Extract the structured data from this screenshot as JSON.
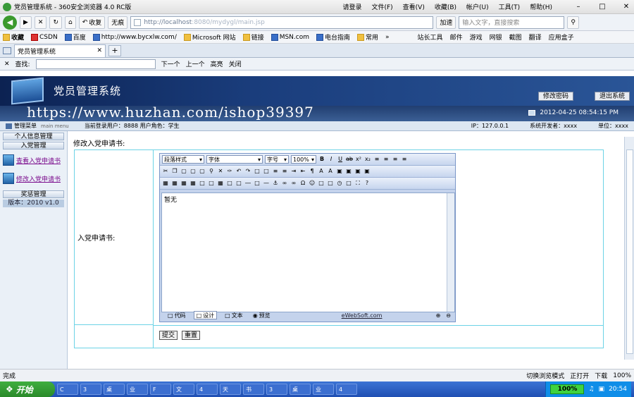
{
  "browser": {
    "window_title": "党员管理系统 - 360安全浏览器 4.0 RC版",
    "menu": [
      "请登录",
      "文件(F)",
      "查看(V)",
      "收藏(B)",
      "帐户(U)",
      "工具(T)",
      "帮助(H)"
    ],
    "nav": {
      "back": "◀",
      "forward": "▶",
      "favorites_btn": "收复",
      "noimage_btn": "无痕"
    },
    "address_host": "http://localhost",
    "address_rest": ":8080/mydygl/main.jsp",
    "accelerate": "加速",
    "search_placeholder": "输入文字，直接搜索",
    "favorites": [
      "收藏",
      "CSDN",
      "百度",
      "http://www.bycxlw.com/",
      "Microsoft 网站",
      "链接",
      "MSN.com",
      "电台指南",
      "常用"
    ],
    "right_tools": [
      "站长工具",
      "邮件",
      "游戏",
      "网银",
      "截图",
      "翻译",
      "应用盒子"
    ],
    "tab_title": "党员管理系统",
    "find_label": "查找:",
    "find_next": "下一个",
    "find_prev": "上一个",
    "highlight": "高亮",
    "close_find": "关闭",
    "status_left": "完成",
    "status_items": [
      "切换浏览模式",
      "正打开",
      "下载",
      "100%"
    ]
  },
  "app": {
    "title": "党员管理系统",
    "change_password": "修改密码",
    "logout": "退出系统",
    "watermark": "https://www.huzhan.com/ishop39397",
    "datetime": "2012-04-25 08:54:15 PM",
    "status": {
      "menu_label": "管理菜单",
      "menu_sub": "main menu",
      "user": "当前登录用户：8888   用户角色：学生",
      "ip": "IP：127.0.0.1",
      "developer": "系统开发者：xxxx",
      "unit": "单位：xxxx"
    },
    "sidebar": {
      "group1": "个人信息管理",
      "group2": "入党管理",
      "link_view": "查看入党申请书",
      "link_edit": "修改入党申请书",
      "group3": "奖惩管理",
      "version": "版本：2010 v1.0"
    },
    "page": {
      "heading": "修改入党申请书:",
      "field_label": "入党申请书:",
      "editor_text": "暂无",
      "paragraph_style": "段落样式",
      "font": "字体",
      "size": "字号",
      "zoom": "100%",
      "modes": [
        "代码",
        "设计",
        "文本",
        "预览"
      ],
      "brand": "eWebSoft.com",
      "submit": "提交",
      "reset": "重置"
    }
  },
  "taskbar": {
    "start": "开始",
    "items": [
      "C",
      "3",
      "桌",
      "业",
      "F",
      "文",
      "4",
      "天",
      "书",
      "3",
      "桌",
      "业",
      "4"
    ],
    "zoom": "100%",
    "time": "20:54"
  }
}
